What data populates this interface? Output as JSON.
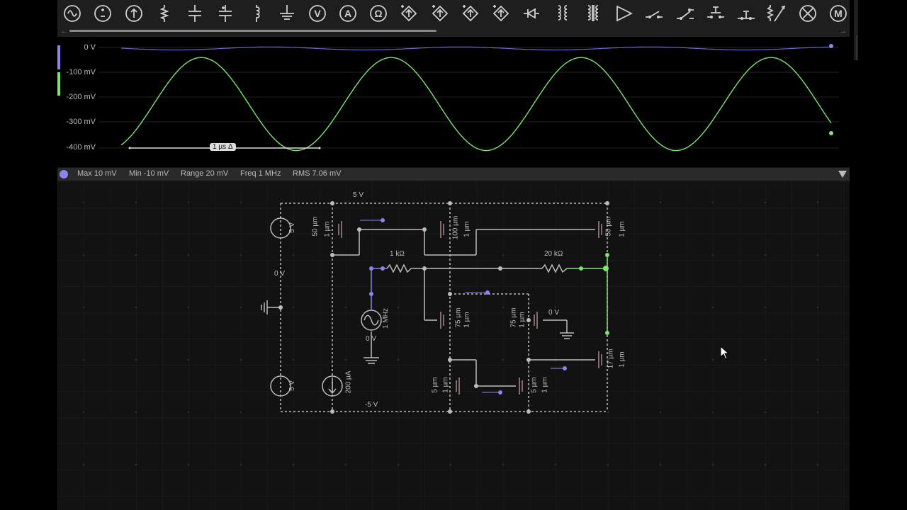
{
  "toolbar": {
    "tools": [
      {
        "icon": "ac-source-icon"
      },
      {
        "icon": "dc-source-icon"
      },
      {
        "icon": "current-source-icon"
      },
      {
        "icon": "resistor-icon"
      },
      {
        "icon": "capacitor-icon"
      },
      {
        "icon": "polar-capacitor-icon"
      },
      {
        "icon": "inductor-icon"
      },
      {
        "icon": "ground-icon"
      },
      {
        "icon": "voltmeter-icon",
        "glyph": "V"
      },
      {
        "icon": "ammeter-icon",
        "glyph": "A"
      },
      {
        "icon": "ohmmeter-icon",
        "glyph": "Ω"
      },
      {
        "icon": "dependent-voltage-source-icon"
      },
      {
        "icon": "dependent-current-source-icon"
      },
      {
        "icon": "dependent-voltage-source-2-icon"
      },
      {
        "icon": "dependent-current-source-2-icon"
      },
      {
        "icon": "diode-icon"
      },
      {
        "icon": "transformer-icon"
      },
      {
        "icon": "coupled-inductor-icon"
      },
      {
        "icon": "opamp-icon"
      },
      {
        "icon": "spst-switch-icon"
      },
      {
        "icon": "spdt-switch-icon"
      },
      {
        "icon": "pushbutton-icon"
      },
      {
        "icon": "pushbutton-nc-icon"
      },
      {
        "icon": "potentiometer-icon"
      },
      {
        "icon": "lamp-icon"
      },
      {
        "icon": "motor-icon",
        "glyph": "M"
      }
    ]
  },
  "scope": {
    "y_labels": [
      "0 V",
      "-100 mV",
      "-200 mV",
      "-300 mV",
      "-400 mV"
    ],
    "delta_label": "1 µs Δ",
    "channel_colors": {
      "ch1": "#8a86f0",
      "ch2": "#7de36f"
    },
    "chart_data": {
      "type": "line",
      "ylim": [
        -0.4,
        0
      ],
      "y_unit": "V",
      "series": [
        {
          "color": "#8a86f0",
          "description": "sine, amplitude 10 mV, centered at 0 V"
        },
        {
          "color": "#7de36f",
          "description": "sine, 1 MHz, swings approx -40 mV to -410 mV"
        }
      ]
    }
  },
  "status": {
    "max": "Max  10 mV",
    "min": "Min  -10 mV",
    "range": "Range  20 mV",
    "freq": "Freq  1 MHz",
    "rms": "RMS  7.06 mV"
  },
  "circuit": {
    "vdd_label": "5 V",
    "vss_label": "-5 V",
    "src_top": "5 V",
    "src_bottom": "5 V",
    "mid_node": "0 V",
    "isrc": "200 µA",
    "r1": "1 kΩ",
    "r2": "20 kΩ",
    "ac_freq": "1 MHz",
    "ac_node": "0 V",
    "bias_node": "0 V",
    "m1_w": "50 µm",
    "m1_l": "1 µm",
    "m2_w": "100 µm",
    "m2_l": "1 µm",
    "m3_w": "50 µm",
    "m3_l": "1 µm",
    "m4_w": "75 µm",
    "m4_l": "1 µm",
    "m5_w": "75 µm",
    "m5_l": "1 µm",
    "m6_w": "17 µm",
    "m6_l": "1 µm",
    "m7_w": "5 µm",
    "m7_l": "1 µm",
    "m8_w": "5 µm",
    "m8_l": "1 µm"
  }
}
